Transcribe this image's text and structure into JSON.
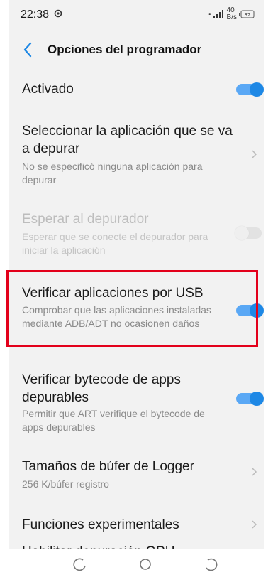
{
  "status_bar": {
    "time": "22:38",
    "net_speed_value": "40",
    "net_speed_unit": "B/s",
    "battery": "32"
  },
  "header": {
    "title": "Opciones del programador"
  },
  "settings": [
    {
      "title": "Activado",
      "toggle": "on"
    },
    {
      "title": "Seleccionar la aplicación que se va a depurar",
      "subtitle": "No se especificó ninguna aplicación para depurar"
    },
    {
      "title": "Esperar al depurador",
      "subtitle": "Esperar que se conecte el depurador para iniciar la aplicación",
      "toggle": "off",
      "enabled": false
    },
    {
      "title": "Verificar aplicaciones por USB",
      "subtitle": "Comprobar que las aplicaciones instaladas mediante ADB/ADT no ocasionen daños",
      "toggle": "on"
    },
    {
      "title": "Verificar bytecode de apps depurables",
      "subtitle": "Permitir que ART verifique el bytecode de apps depurables",
      "toggle": "on"
    },
    {
      "title": "Tamaños de búfer de Logger",
      "subtitle": "256 K/búfer registro"
    },
    {
      "title": "Funciones experimentales"
    },
    {
      "title": "Habilitar depuración GPU"
    }
  ],
  "colors": {
    "accent": "#1e88e5",
    "highlight": "#e3001b"
  },
  "nav_bar": {
    "icons": [
      "recents-icon",
      "home-icon",
      "back-nav-icon"
    ]
  }
}
